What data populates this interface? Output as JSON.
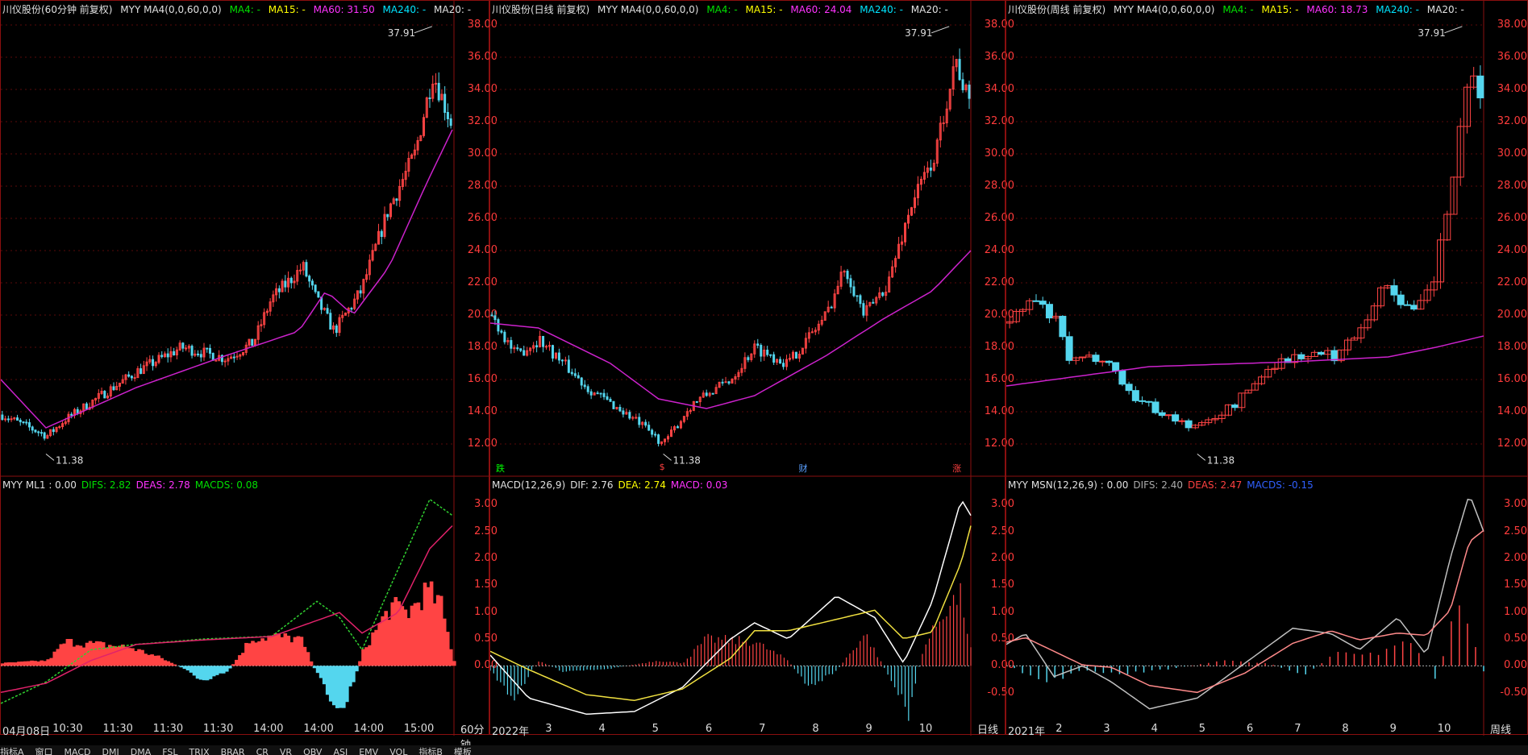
{
  "panels": [
    {
      "id": "p1",
      "title": "川仪股份(60分钟 前复权)",
      "indicator": "MYY MA4(0,0,60,0,0)",
      "ma": {
        "ma4": "MA4: -",
        "ma15": "MA15: -",
        "ma60": "MA60: 31.50",
        "ma240": "MA240: -",
        "ma20": "MA20: -"
      },
      "high_label": "37.91",
      "low_label": "11.38",
      "y_ticks": [
        "38.00",
        "36.00",
        "34.00",
        "32.00",
        "30.00",
        "28.00",
        "26.00",
        "24.00",
        "22.00",
        "20.00",
        "18.00",
        "16.00",
        "14.00",
        "12.00"
      ],
      "sub_title": "MYY ML1 : 0.00",
      "sub_vals": {
        "a": "DIFS: 2.82",
        "b": "DEAS: 2.78",
        "c": "MACDS: 0.08"
      },
      "sub_ticks": [
        "3.00",
        "2.50",
        "2.00",
        "1.50",
        "1.00",
        "0.50",
        "0.00"
      ],
      "x_labels": [
        "04月08日",
        "10:30",
        "11:30",
        "11:30",
        "11:30",
        "14:00",
        "14:00",
        "14:00",
        "15:00"
      ],
      "period": "60分钟"
    },
    {
      "id": "p2",
      "title": "川仪股份(日线 前复权)",
      "indicator": "MYY MA4(0,0,60,0,0)",
      "ma": {
        "ma4": "MA4: -",
        "ma15": "MA15: -",
        "ma60": "MA60: 24.04",
        "ma240": "MA240: -",
        "ma20": "MA20: -"
      },
      "high_label": "37.91",
      "low_label": "11.38",
      "y_ticks": [
        "38.00",
        "36.00",
        "34.00",
        "32.00",
        "30.00",
        "28.00",
        "26.00",
        "24.00",
        "22.00",
        "20.00",
        "18.00",
        "16.00",
        "14.00",
        "12.00"
      ],
      "sub_title": "MACD(12,26,9)",
      "sub_vals": {
        "a": "DIF: 2.76",
        "b": "DEA: 2.74",
        "c": "MACD: 0.03"
      },
      "sub_ticks": [
        "3.00",
        "2.50",
        "2.00",
        "1.50",
        "1.00",
        "0.50",
        "0.00",
        "-0.50"
      ],
      "x_labels": [
        "2022年",
        "3",
        "4",
        "5",
        "6",
        "7",
        "8",
        "9",
        "10"
      ],
      "period": "日线",
      "marks": [
        "跌",
        "$",
        "财",
        "涨"
      ]
    },
    {
      "id": "p3",
      "title": "川仪股份(周线 前复权)",
      "indicator": "MYY MA4(0,0,60,0,0)",
      "ma": {
        "ma4": "MA4: -",
        "ma15": "MA15: -",
        "ma60": "MA60: 18.73",
        "ma240": "MA240: -",
        "ma20": "MA20: -"
      },
      "high_label": "37.91",
      "low_label": "11.38",
      "y_ticks": [
        "38.00",
        "36.00",
        "34.00",
        "32.00",
        "30.00",
        "28.00",
        "26.00",
        "24.00",
        "22.00",
        "20.00",
        "18.00",
        "16.00",
        "14.00",
        "12.00"
      ],
      "sub_title": "MYY MSN(12,26,9) : 0.00",
      "sub_vals": {
        "a": "DIFS: 2.40",
        "b": "DEAS: 2.47",
        "c": "MACDS: -0.15"
      },
      "sub_ticks": [
        "3.00",
        "2.50",
        "2.00",
        "1.50",
        "1.00",
        "0.50",
        "0.00",
        "-0.50"
      ],
      "x_labels": [
        "2021年",
        "2",
        "3",
        "4",
        "5",
        "6",
        "7",
        "8",
        "9",
        "10"
      ],
      "period": "周线"
    }
  ],
  "footer": [
    "指标A",
    "窗口",
    "MACD",
    "DMI",
    "DMA",
    "FSL",
    "TRIX",
    "BRAR",
    "CR",
    "VR",
    "OBV",
    "ASI",
    "EMV",
    "VOL",
    "指标B",
    "模板"
  ],
  "colors": {
    "up": "#ff4444",
    "down": "#54d6ee",
    "ma60": "#cc22cc",
    "grid": "#5a0a0a",
    "axis": "#ff3b3b"
  }
}
